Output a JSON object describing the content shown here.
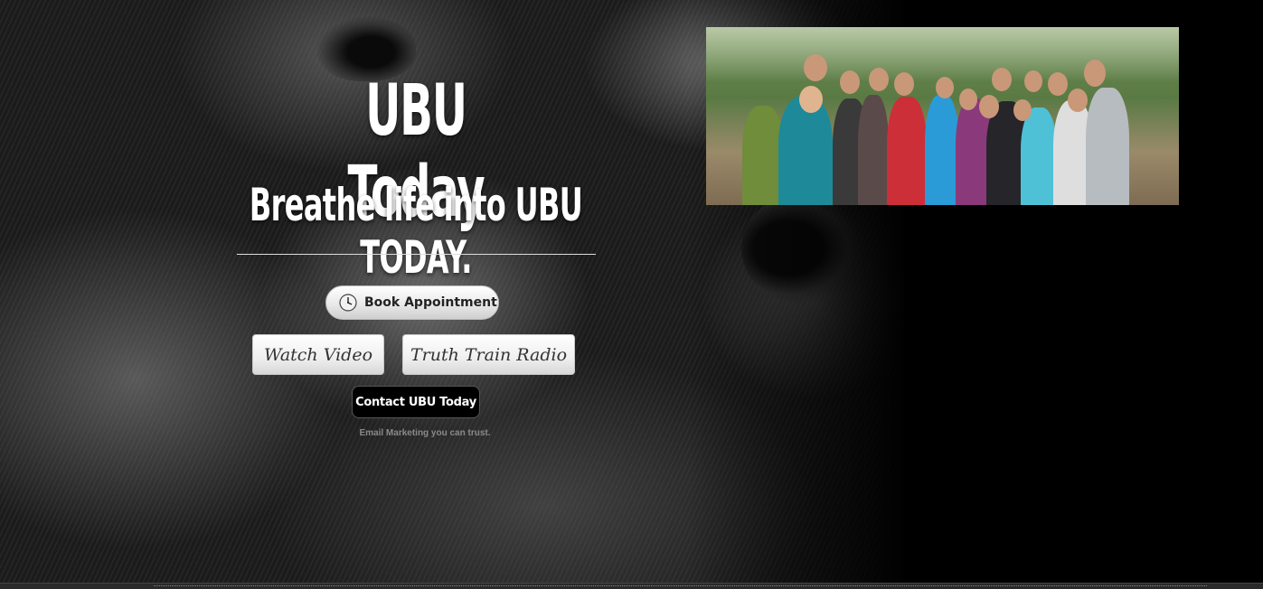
{
  "header": {
    "title": "UBU Today",
    "subtitle": "Breathe life into UBU TODAY."
  },
  "actions": {
    "book_appointment": "Book Appointment",
    "watch_video": "Watch Video",
    "truth_train_radio": "Truth Train Radio",
    "contact": "Contact UBU Today"
  },
  "footer": {
    "tagline": "Email Marketing you can trust."
  },
  "icons": {
    "book": "clock-icon"
  },
  "colors": {
    "background": "#000000",
    "text": "#ffffff",
    "button_light": "#eeeeee",
    "button_dark": "#000000"
  }
}
